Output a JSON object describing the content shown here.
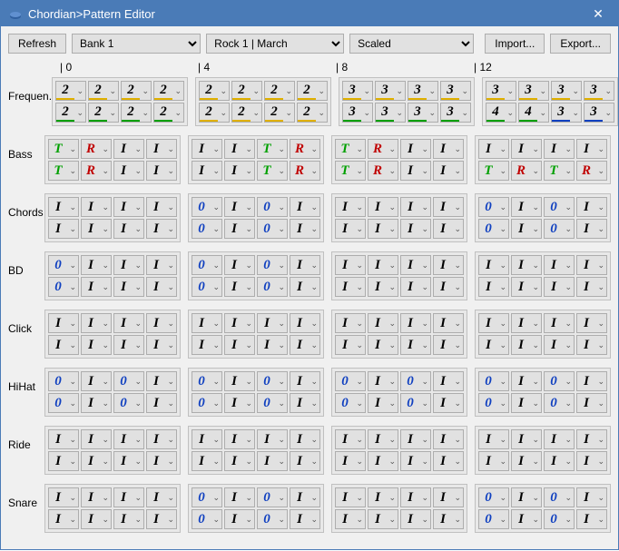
{
  "window": {
    "title": "Chordian>Pattern Editor"
  },
  "toolbar": {
    "refresh": "Refresh",
    "bank": "Bank 1",
    "preset": "Rock 1 | March",
    "mode": "Scaled",
    "import": "Import...",
    "export": "Export..."
  },
  "beat_labels": [
    "0",
    "4",
    "8",
    "12"
  ],
  "tracks": [
    {
      "name": "Frequen.",
      "rows": [
        [
          [
            "2y",
            "2y",
            "2y",
            "2y"
          ],
          [
            "2y",
            "2y",
            "2y",
            "2y"
          ],
          [
            "3y",
            "3y",
            "3y",
            "3y"
          ],
          [
            "3y",
            "3y",
            "3y",
            "3y"
          ]
        ],
        [
          [
            "2g",
            "2g",
            "2g",
            "2g"
          ],
          [
            "2y",
            "2y",
            "2y",
            "2y"
          ],
          [
            "3g",
            "3g",
            "3g",
            "3g"
          ],
          [
            "4g",
            "4g",
            "3b",
            "3b"
          ]
        ]
      ]
    },
    {
      "name": "Bass",
      "rows": [
        [
          [
            "T",
            "R",
            "I",
            "I"
          ],
          [
            "I",
            "I",
            "T",
            "R"
          ],
          [
            "T",
            "R",
            "I",
            "I"
          ],
          [
            "I",
            "I",
            "I",
            "I"
          ]
        ],
        [
          [
            "T",
            "R",
            "I",
            "I"
          ],
          [
            "I",
            "I",
            "T",
            "R"
          ],
          [
            "T",
            "R",
            "I",
            "I"
          ],
          [
            "T",
            "R",
            "T",
            "R"
          ]
        ]
      ]
    },
    {
      "name": "Chords",
      "rows": [
        [
          [
            "I",
            "I",
            "I",
            "I"
          ],
          [
            "0",
            "I",
            "0",
            "I"
          ],
          [
            "I",
            "I",
            "I",
            "I"
          ],
          [
            "0",
            "I",
            "0",
            "I"
          ]
        ],
        [
          [
            "I",
            "I",
            "I",
            "I"
          ],
          [
            "0",
            "I",
            "0",
            "I"
          ],
          [
            "I",
            "I",
            "I",
            "I"
          ],
          [
            "0",
            "I",
            "0",
            "I"
          ]
        ]
      ]
    },
    {
      "name": "BD",
      "rows": [
        [
          [
            "0",
            "I",
            "I",
            "I"
          ],
          [
            "0",
            "I",
            "0",
            "I"
          ],
          [
            "I",
            "I",
            "I",
            "I"
          ],
          [
            "I",
            "I",
            "I",
            "I"
          ]
        ],
        [
          [
            "0",
            "I",
            "I",
            "I"
          ],
          [
            "0",
            "I",
            "0",
            "I"
          ],
          [
            "I",
            "I",
            "I",
            "I"
          ],
          [
            "I",
            "I",
            "I",
            "I"
          ]
        ]
      ]
    },
    {
      "name": "Click",
      "rows": [
        [
          [
            "I",
            "I",
            "I",
            "I"
          ],
          [
            "I",
            "I",
            "I",
            "I"
          ],
          [
            "I",
            "I",
            "I",
            "I"
          ],
          [
            "I",
            "I",
            "I",
            "I"
          ]
        ],
        [
          [
            "I",
            "I",
            "I",
            "I"
          ],
          [
            "I",
            "I",
            "I",
            "I"
          ],
          [
            "I",
            "I",
            "I",
            "I"
          ],
          [
            "I",
            "I",
            "I",
            "I"
          ]
        ]
      ]
    },
    {
      "name": "HiHat",
      "rows": [
        [
          [
            "0",
            "I",
            "0",
            "I"
          ],
          [
            "0",
            "I",
            "0",
            "I"
          ],
          [
            "0",
            "I",
            "0",
            "I"
          ],
          [
            "0",
            "I",
            "0",
            "I"
          ]
        ],
        [
          [
            "0",
            "I",
            "0",
            "I"
          ],
          [
            "0",
            "I",
            "0",
            "I"
          ],
          [
            "0",
            "I",
            "0",
            "I"
          ],
          [
            "0",
            "I",
            "0",
            "I"
          ]
        ]
      ]
    },
    {
      "name": "Ride",
      "rows": [
        [
          [
            "I",
            "I",
            "I",
            "I"
          ],
          [
            "I",
            "I",
            "I",
            "I"
          ],
          [
            "I",
            "I",
            "I",
            "I"
          ],
          [
            "I",
            "I",
            "I",
            "I"
          ]
        ],
        [
          [
            "I",
            "I",
            "I",
            "I"
          ],
          [
            "I",
            "I",
            "I",
            "I"
          ],
          [
            "I",
            "I",
            "I",
            "I"
          ],
          [
            "I",
            "I",
            "I",
            "I"
          ]
        ]
      ]
    },
    {
      "name": "Snare",
      "rows": [
        [
          [
            "I",
            "I",
            "I",
            "I"
          ],
          [
            "0",
            "I",
            "0",
            "I"
          ],
          [
            "I",
            "I",
            "I",
            "I"
          ],
          [
            "0",
            "I",
            "0",
            "I"
          ]
        ],
        [
          [
            "I",
            "I",
            "I",
            "I"
          ],
          [
            "0",
            "I",
            "0",
            "I"
          ],
          [
            "I",
            "I",
            "I",
            "I"
          ],
          [
            "0",
            "I",
            "0",
            "I"
          ]
        ]
      ]
    }
  ],
  "glyph_text": {
    "I": "I",
    "0": "0",
    "T": "T",
    "R": "R",
    "2y": "2",
    "2g": "2",
    "3y": "3",
    "3g": "3",
    "3b": "3",
    "4g": "4"
  }
}
